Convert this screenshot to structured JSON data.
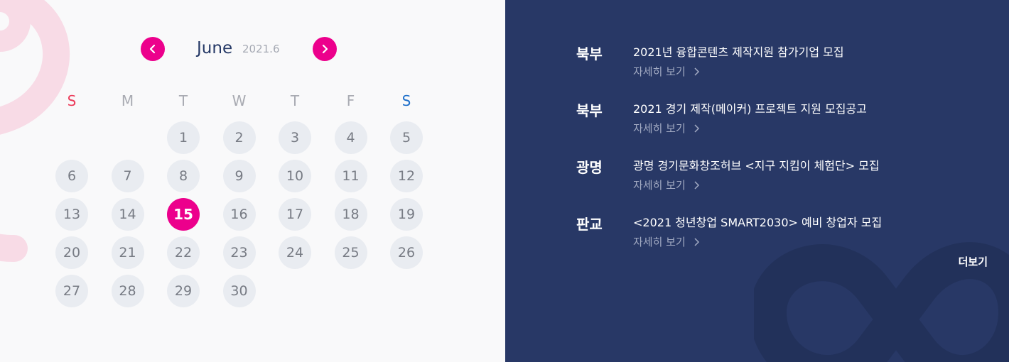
{
  "calendar": {
    "month": "June",
    "year_month": "2021.6",
    "weekdays": [
      "S",
      "M",
      "T",
      "W",
      "T",
      "F",
      "S"
    ],
    "days": [
      "1",
      "2",
      "3",
      "4",
      "5",
      "6",
      "7",
      "8",
      "9",
      "10",
      "11",
      "12",
      "13",
      "14",
      "15",
      "16",
      "17",
      "18",
      "19",
      "20",
      "21",
      "22",
      "23",
      "24",
      "25",
      "26",
      "27",
      "28",
      "29",
      "30"
    ],
    "today": "15",
    "colors": {
      "accent": "#ec008c",
      "sunday": "#ec3c5a",
      "saturday": "#1e6fca",
      "day_bg": "#e9ecf1"
    }
  },
  "news": {
    "items": [
      {
        "region": "북부",
        "title": "2021년 융합콘텐츠 제작지원 참가기업 모집",
        "detail": "자세히 보기"
      },
      {
        "region": "북부",
        "title": "2021 경기 제작(메이커) 프로젝트 지원 모집공고",
        "detail": "자세히 보기"
      },
      {
        "region": "광명",
        "title": "광명 경기문화창조허브 <지구 지킴이 체험단> 모집",
        "detail": "자세히 보기"
      },
      {
        "region": "판교",
        "title": "<2021 청년창업 SMART2030> 예비 창업자 모집",
        "detail": "자세히 보기"
      }
    ],
    "more_label": "더보기",
    "colors": {
      "background": "#283866"
    }
  }
}
